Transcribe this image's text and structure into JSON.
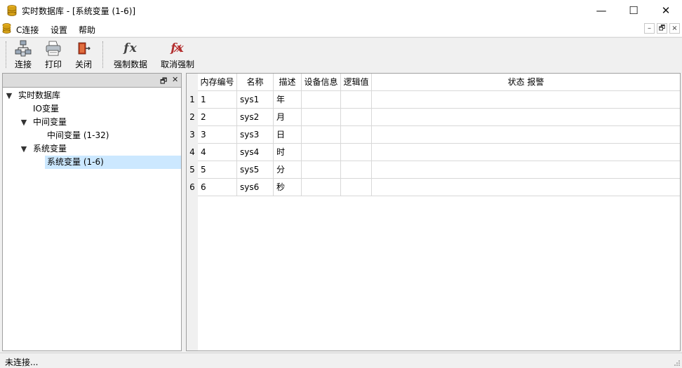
{
  "window": {
    "title": "实时数据库 - [系统变量 (1-6)]",
    "controls": {
      "minimize": "—",
      "maximize": "☐",
      "close": "✕"
    }
  },
  "menu": {
    "items": [
      "C连接",
      "设置",
      "帮助"
    ],
    "mdi": {
      "minimize": "–",
      "restore": "🗗",
      "close": "×"
    }
  },
  "toolbar": {
    "buttons": [
      {
        "label": "连接",
        "icon": "network-icon"
      },
      {
        "label": "打印",
        "icon": "printer-icon"
      },
      {
        "label": "关闭",
        "icon": "exit-door-icon"
      },
      {
        "label": "强制数据",
        "icon": "fx-icon",
        "glyph": "fx"
      },
      {
        "label": "取消强制",
        "icon": "fx-cancel-icon",
        "glyph": "fx"
      }
    ]
  },
  "left_panel": {
    "header_buttons": {
      "float": "🗗",
      "close": "✕"
    },
    "tree": [
      {
        "label": "实时数据库",
        "level": 0,
        "expanded": true
      },
      {
        "label": "IO变量",
        "level": 1
      },
      {
        "label": "中间变量",
        "level": 1,
        "expanded": true
      },
      {
        "label": "中间变量 (1-32)",
        "level": 2
      },
      {
        "label": "系统变量",
        "level": 1,
        "expanded": true
      },
      {
        "label": "系统变量 (1-6)",
        "level": 2,
        "selected": true
      }
    ]
  },
  "grid": {
    "columns": [
      "内存编号",
      "名称",
      "描述",
      "设备信息",
      "逻辑值",
      "状态 报警"
    ],
    "rows": [
      {
        "num": "1",
        "cells": [
          "1",
          "sys1",
          "年",
          "",
          "",
          ""
        ]
      },
      {
        "num": "2",
        "cells": [
          "2",
          "sys2",
          "月",
          "",
          "",
          ""
        ]
      },
      {
        "num": "3",
        "cells": [
          "3",
          "sys3",
          "日",
          "",
          "",
          ""
        ]
      },
      {
        "num": "4",
        "cells": [
          "4",
          "sys4",
          "时",
          "",
          "",
          ""
        ]
      },
      {
        "num": "5",
        "cells": [
          "5",
          "sys5",
          "分",
          "",
          "",
          ""
        ]
      },
      {
        "num": "6",
        "cells": [
          "6",
          "sys6",
          "秒",
          "",
          "",
          ""
        ]
      }
    ]
  },
  "status": {
    "text": "未连接..."
  },
  "colors": {
    "selection": "#cce8ff",
    "header_bg": "#dcdcdc",
    "db_icon": "#d4a017"
  }
}
